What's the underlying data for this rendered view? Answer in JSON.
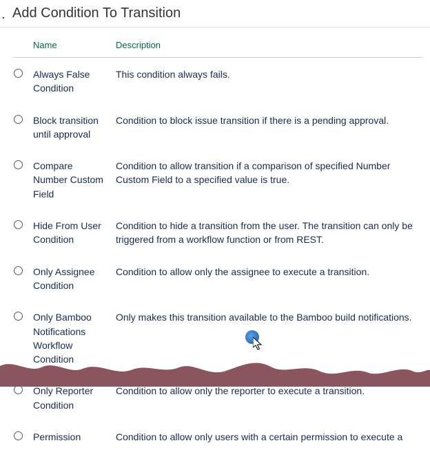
{
  "page": {
    "title": "Add Condition To Transition"
  },
  "table": {
    "headers": {
      "name": "Name",
      "description": "Description"
    },
    "rows": [
      {
        "name": "Always False Condition",
        "description": "This condition always fails."
      },
      {
        "name": "Block transition until approval",
        "description": "Condition to block issue transition if there is a pending approval."
      },
      {
        "name": "Compare Number Custom Field",
        "description": "Condition to allow transition if a comparison of specified Number Custom Field to a specified value is true."
      },
      {
        "name": "Hide From User Condition",
        "description": "Condition to hide a transition from the user. The transition can only be triggered from a workflow function or from REST."
      },
      {
        "name": "Only Assignee Condition",
        "description": "Condition to allow only the assignee to execute a transition."
      },
      {
        "name": "Only Bamboo Notifications Workflow Condition",
        "description": "Only makes this transition available to the Bamboo build notifications."
      },
      {
        "name": "Only Reporter Condition",
        "description": "Condition to allow only the reporter to execute a transition."
      },
      {
        "name": "Permission",
        "description": "Condition to allow only users with a certain permission to execute a"
      }
    ]
  }
}
